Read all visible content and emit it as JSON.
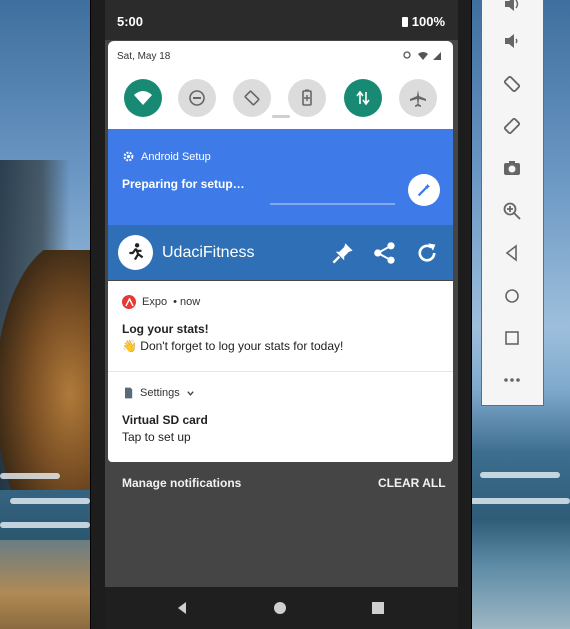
{
  "status_bar": {
    "time": "5:00",
    "battery": "100%"
  },
  "quick_settings": {
    "date": "Sat, May 18",
    "tiles": [
      {
        "name": "wifi",
        "on": true
      },
      {
        "name": "do-not-disturb",
        "on": false
      },
      {
        "name": "auto-rotate",
        "on": false
      },
      {
        "name": "battery-saver",
        "on": false
      },
      {
        "name": "mobile-data",
        "on": true
      },
      {
        "name": "airplane-mode",
        "on": false
      }
    ]
  },
  "android_setup": {
    "app": "Android Setup",
    "title": "Preparing for setup…"
  },
  "udacifitness": {
    "name": "UdaciFitness"
  },
  "expo_notification": {
    "app": "Expo",
    "time": "• now",
    "title": "Log your stats!",
    "body": "👋 Don't forget to log your stats for today!"
  },
  "settings_notification": {
    "app": "Settings",
    "title": "Virtual SD card",
    "body": "Tap to set up"
  },
  "footer": {
    "manage": "Manage notifications",
    "clear_all": "CLEAR ALL"
  },
  "colors": {
    "accent_teal": "#188a73",
    "setup_blue": "#3f7be8",
    "udaci_blue": "#2f6fb6"
  }
}
